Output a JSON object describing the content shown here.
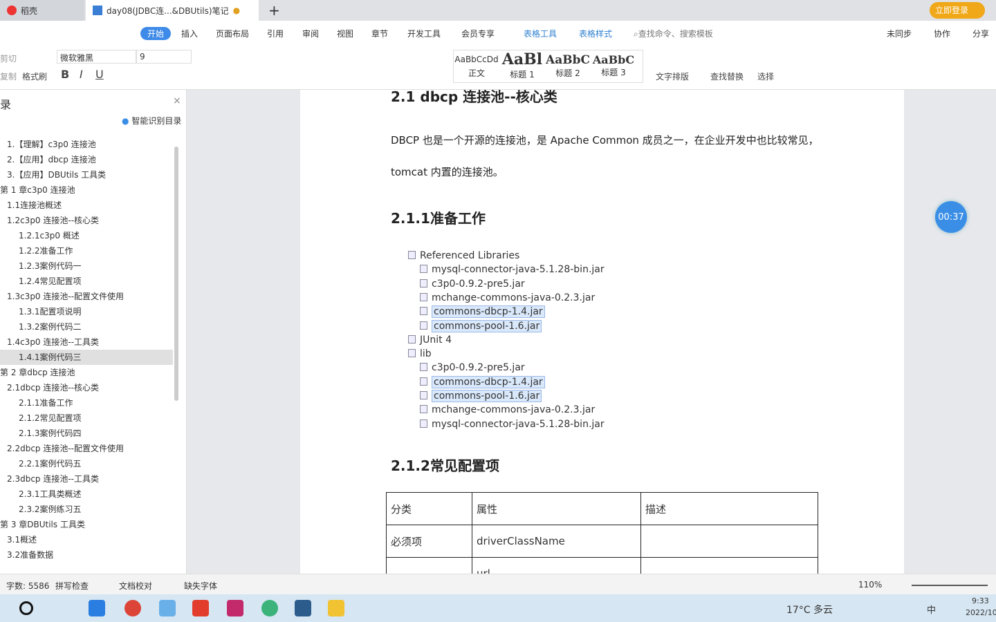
{
  "tabs": [
    {
      "label": "稻壳"
    },
    {
      "label": "day08(JDBC连...&DBUtils)笔记"
    }
  ],
  "login": "立即登录",
  "menu": [
    "开始",
    "插入",
    "页面布局",
    "引用",
    "审阅",
    "视图",
    "章节",
    "开发工具",
    "会员专享",
    "表格工具",
    "表格样式"
  ],
  "search_placeholder": "查找命令、搜索模板",
  "right_actions": [
    "未同步",
    "协作",
    "分享"
  ],
  "toolbar": {
    "cut": "剪切",
    "copy": "复制",
    "format_painter": "格式刷",
    "font": "微软雅黑",
    "size": "9",
    "styles": [
      {
        "preview": "AaBbCcDd",
        "label": "正文"
      },
      {
        "preview": "AaBl",
        "label": "标题 1"
      },
      {
        "preview": "AaBbC",
        "label": "标题 2"
      },
      {
        "preview": "AaBbC",
        "label": "标题 3"
      }
    ],
    "text_layout": "文字排版",
    "find_replace": "查找替换",
    "select": "选择"
  },
  "nav": {
    "title": "录",
    "smart": "智能识别目录",
    "items": [
      "1.【理解】c3p0 连接池",
      "2.【应用】dbcp 连接池",
      "3.【应用】DBUtils 工具类",
      "第 1 章c3p0 连接池",
      "1.1连接池概述",
      "1.2c3p0 连接池--核心类",
      "1.2.1c3p0 概述",
      "1.2.2准备工作",
      "1.2.3案例代码一",
      "1.2.4常见配置项",
      "1.3c3p0 连接池--配置文件使用",
      "1.3.1配置项说明",
      "1.3.2案例代码二",
      "1.4c3p0 连接池--工具类",
      "1.4.1案例代码三",
      "第 2 章dbcp 连接池",
      "2.1dbcp 连接池--核心类",
      "2.1.1准备工作",
      "2.1.2常见配置项",
      "2.1.3案例代码四",
      "2.2dbcp 连接池--配置文件使用",
      "2.2.1案例代码五",
      "2.3dbcp 连接池--工具类",
      "2.3.1工具类概述",
      "2.3.2案例练习五",
      "第 3 章DBUtils 工具类",
      "3.1概述",
      "3.2准备数据"
    ],
    "selected": "1.4.1案例代码三"
  },
  "doc": {
    "h_top": "2.1 dbcp 连接池--核心类",
    "para1": "DBCP 也是一个开源的连接池，是 Apache Common 成员之一，在企业开发中也比较常见，",
    "para2": "tomcat 内置的连接池。",
    "h1": "2.1.1准备工作",
    "tree": [
      "Referenced Libraries",
      "mysql-connector-java-5.1.28-bin.jar",
      "c3p0-0.9.2-pre5.jar",
      "mchange-commons-java-0.2.3.jar",
      "commons-dbcp-1.4.jar",
      "commons-pool-1.6.jar",
      "JUnit 4",
      "lib",
      "c3p0-0.9.2-pre5.jar",
      "commons-dbcp-1.4.jar",
      "commons-pool-1.6.jar",
      "mchange-commons-java-0.2.3.jar",
      "mysql-connector-java-5.1.28-bin.jar"
    ],
    "h2": "2.1.2常见配置项",
    "table": {
      "headers": [
        "分类",
        "属性",
        "描述"
      ],
      "rows": [
        [
          "必须项",
          "driverClassName",
          ""
        ],
        [
          "",
          "url",
          ""
        ]
      ]
    }
  },
  "timer": "00:37",
  "status": {
    "words": "字数: 5586",
    "spell": "拼写检查",
    "proof": "文档校对",
    "missing_font": "缺失字体",
    "zoom": "110%"
  },
  "taskbar": {
    "weather": "17°C 多云",
    "time": "9:33",
    "date": "2022/10",
    "ime": "中"
  }
}
